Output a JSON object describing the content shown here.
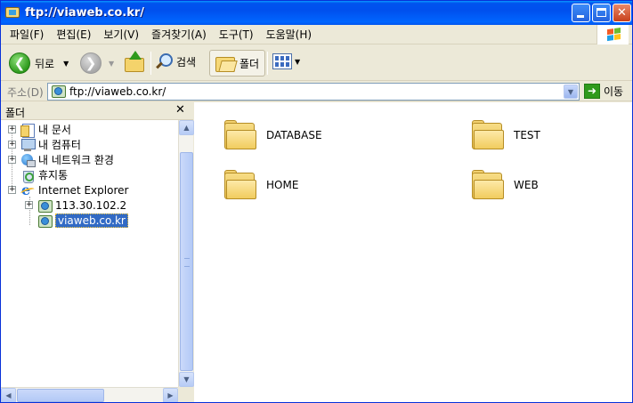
{
  "window": {
    "title": "ftp://viaweb.co.kr/",
    "min_symbol": "",
    "max_symbol": "",
    "close_symbol": "✕"
  },
  "menubar": {
    "items": [
      "파일(F)",
      "편집(E)",
      "보기(V)",
      "즐겨찾기(A)",
      "도구(T)",
      "도움말(H)"
    ]
  },
  "toolbar": {
    "back_label": "뒤로",
    "search_label": "검색",
    "folders_label": "폴더",
    "dropdown_glyph": "▼",
    "back_glyph": "❮",
    "forward_glyph": "❯"
  },
  "address": {
    "label": "주소(D)",
    "value": "ftp://viaweb.co.kr/",
    "go_label": "이동",
    "go_glyph": "➜",
    "dropdown_glyph": "▼"
  },
  "folder_pane": {
    "title": "폴더",
    "close_glyph": "✕",
    "tree": [
      {
        "label": "내 문서",
        "icon": "my-documents-icon",
        "expander": "+"
      },
      {
        "label": "내 컴퓨터",
        "icon": "my-computer-icon",
        "expander": "+"
      },
      {
        "label": "내 네트워크 환경",
        "icon": "network-icon",
        "expander": "+"
      },
      {
        "label": "휴지통",
        "icon": "recycle-bin-icon",
        "expander": ""
      },
      {
        "label": "Internet Explorer",
        "icon": "internet-explorer-icon",
        "expander": "+"
      },
      {
        "label": "113.30.102.2",
        "icon": "ftp-site-icon",
        "expander": "+"
      },
      {
        "label": "viaweb.co.kr",
        "icon": "ftp-site-icon",
        "expander": "",
        "selected": true
      }
    ],
    "scroll_up": "▲",
    "scroll_down": "▼",
    "scroll_left": "◀",
    "scroll_right": "▶"
  },
  "content": {
    "folders": [
      "DATABASE",
      "TEST",
      "HOME",
      "WEB"
    ]
  }
}
